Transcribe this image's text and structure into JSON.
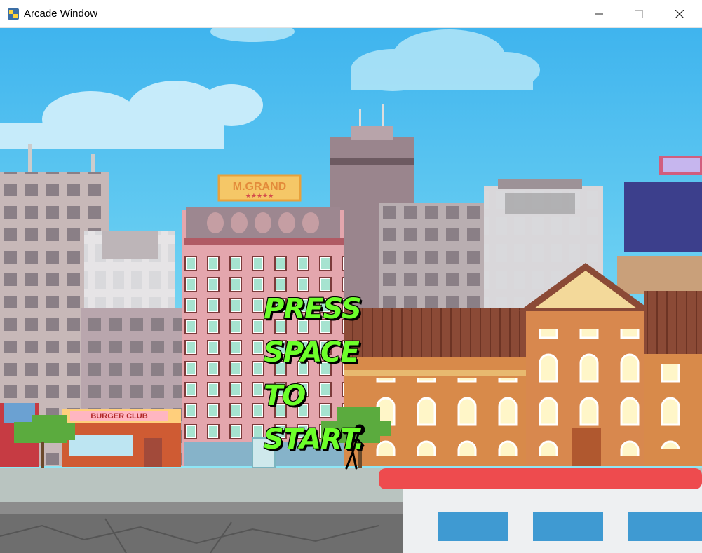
{
  "window": {
    "title": "Arcade Window",
    "controls": {
      "minimize": "—",
      "maximize": "☐",
      "close": "✕"
    }
  },
  "scene": {
    "prompt_lines": [
      "PRESS",
      "SPACE",
      "TO",
      "START."
    ],
    "signs": {
      "hotel": "M.GRAND",
      "hotel_stars": "★★★★★",
      "shop": "BURGER CLUB"
    },
    "colors": {
      "sky": "#5ec8f0",
      "prompt_text": "#6dff2a",
      "rooftop": "#e84a4a"
    }
  }
}
